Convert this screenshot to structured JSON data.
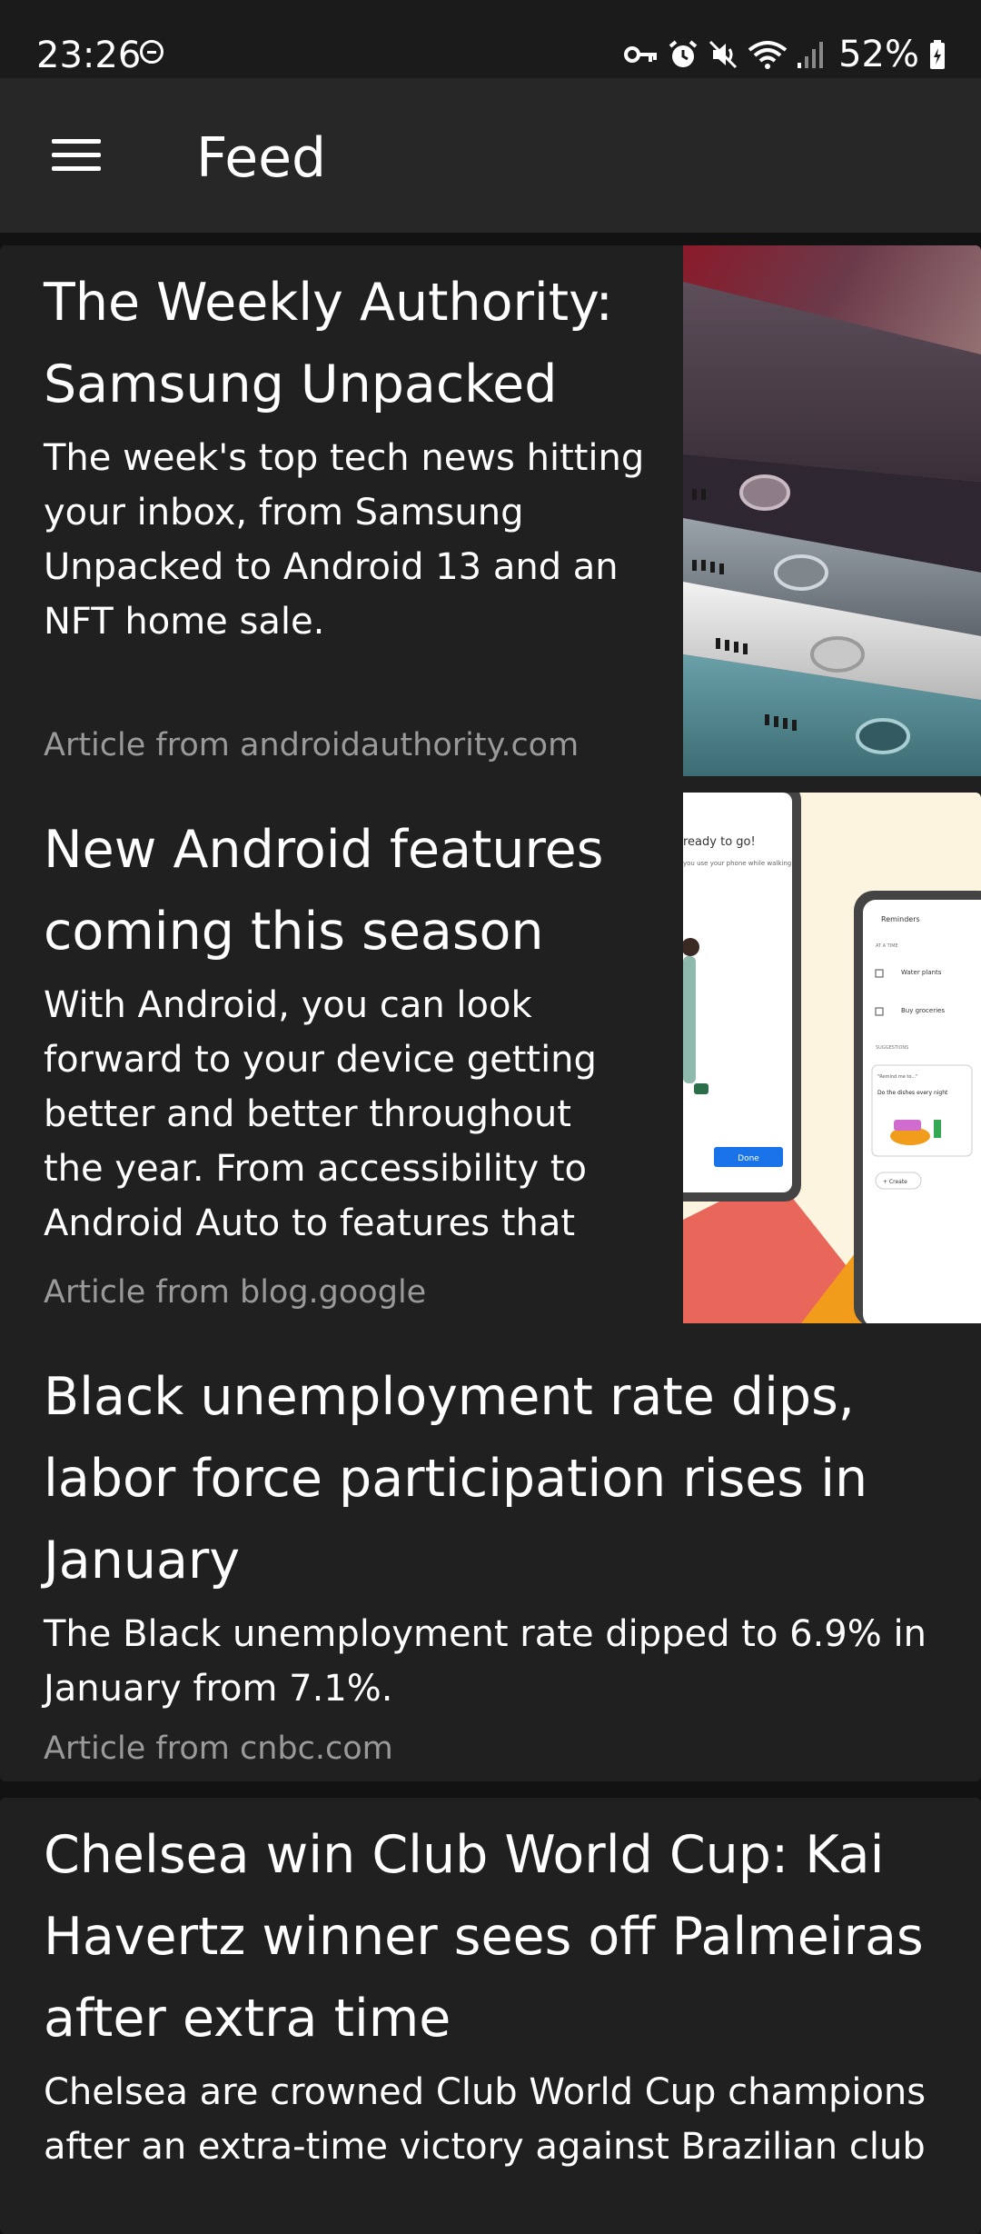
{
  "status_bar": {
    "time": "23:26",
    "battery": "52%",
    "icons": [
      "do-not-disturb-icon",
      "vpn-key-icon",
      "alarm-icon",
      "mute-icon",
      "wifi-icon",
      "signal-icon",
      "battery-icon"
    ]
  },
  "app_bar": {
    "menu_icon": "hamburger-menu-icon",
    "title": "Feed"
  },
  "feed": [
    {
      "title_lines": [
        "The Weekly Authority:",
        "Samsung Unpacked"
      ],
      "summary_lines": [
        "The week's top tech news hitting",
        "your inbox, from Samsung",
        "Unpacked to Android 13 and an",
        "NFT home sale."
      ],
      "source": "Article from androidauthority.com",
      "thumbnail": "stacked-smartphones-image"
    },
    {
      "title_lines": [
        "New Android features",
        "coming this season"
      ],
      "summary_lines": [
        "With Android, you can look",
        "forward to your device getting",
        "better and better throughout",
        "the year. From accessibility to",
        "Android Auto to features that"
      ],
      "source": "Article from blog.google",
      "thumbnail": "android-phones-illustration-image",
      "thumbnail_text": {
        "ready": "ready to go!",
        "hint": "you use your phone while walking",
        "done": "Done",
        "reminders": "Reminders",
        "at_a_time": "AT A TIME",
        "item1": "Water plants",
        "item2": "Buy groceries",
        "suggestions": "SUGGESTIONS",
        "remind_me": "\"Remind me to...\"",
        "dishes": "Do the dishes every night",
        "create": "+ Create"
      }
    },
    {
      "title_lines": [
        "Black unemployment rate dips,",
        "labor force participation rises in",
        "January"
      ],
      "summary_lines": [
        "The Black unemployment rate dipped to 6.9% in",
        "January from 7.1%."
      ],
      "source": "Article from cnbc.com"
    },
    {
      "title_lines": [
        "Chelsea win Club World Cup: Kai",
        "Havertz winner sees off Palmeiras",
        "after extra time"
      ],
      "summary_lines": [
        "Chelsea are crowned Club World Cup champions",
        "after an extra-time victory against Brazilian club"
      ],
      "source": ""
    }
  ],
  "colors": {
    "background": "#121212",
    "card": "#202020",
    "app_bar": "#272727",
    "status_bar": "#1b1b1b",
    "source_text": "#9a9a9a"
  }
}
